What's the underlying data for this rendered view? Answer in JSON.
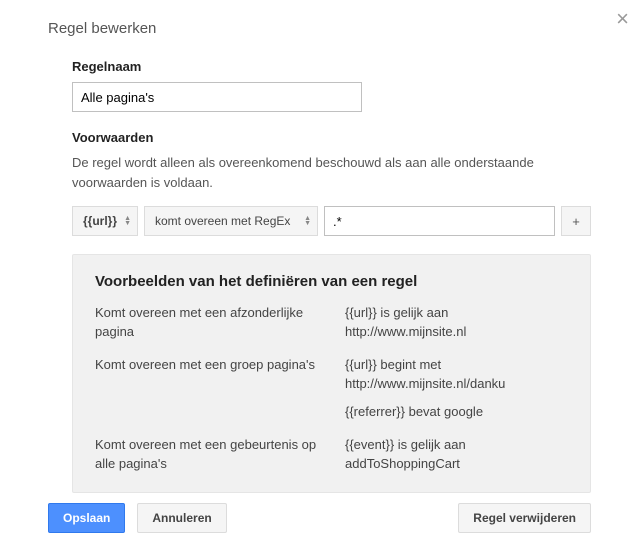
{
  "dialog": {
    "title": "Regel bewerken",
    "close_label": "×"
  },
  "rule_name": {
    "label": "Regelnaam",
    "value": "Alle pagina's"
  },
  "conditions": {
    "label": "Voorwaarden",
    "description": "De regel wordt alleen als overeenkomend beschouwd als aan alle onderstaande voorwaarden is voldaan.",
    "row": {
      "variable": "{{url}}",
      "operator": "komt overeen met RegEx",
      "value": ".*",
      "add_label": "+"
    }
  },
  "examples": {
    "title": "Voorbeelden van het definiëren van een regel",
    "rows": [
      {
        "left": "Komt overeen met een afzonderlijke pagina",
        "right": [
          "{{url}} is gelijk aan http://www.mijnsite.nl"
        ]
      },
      {
        "left": "Komt overeen met een groep pagina's",
        "right": [
          "{{url}} begint met http://www.mijnsite.nl/danku",
          "{{referrer}} bevat google"
        ]
      },
      {
        "left": "Komt overeen met een gebeurtenis op alle pagina's",
        "right": [
          "{{event}} is gelijk aan addToShoppingCart"
        ]
      }
    ]
  },
  "footer": {
    "save": "Opslaan",
    "cancel": "Annuleren",
    "delete": "Regel verwijderen"
  }
}
